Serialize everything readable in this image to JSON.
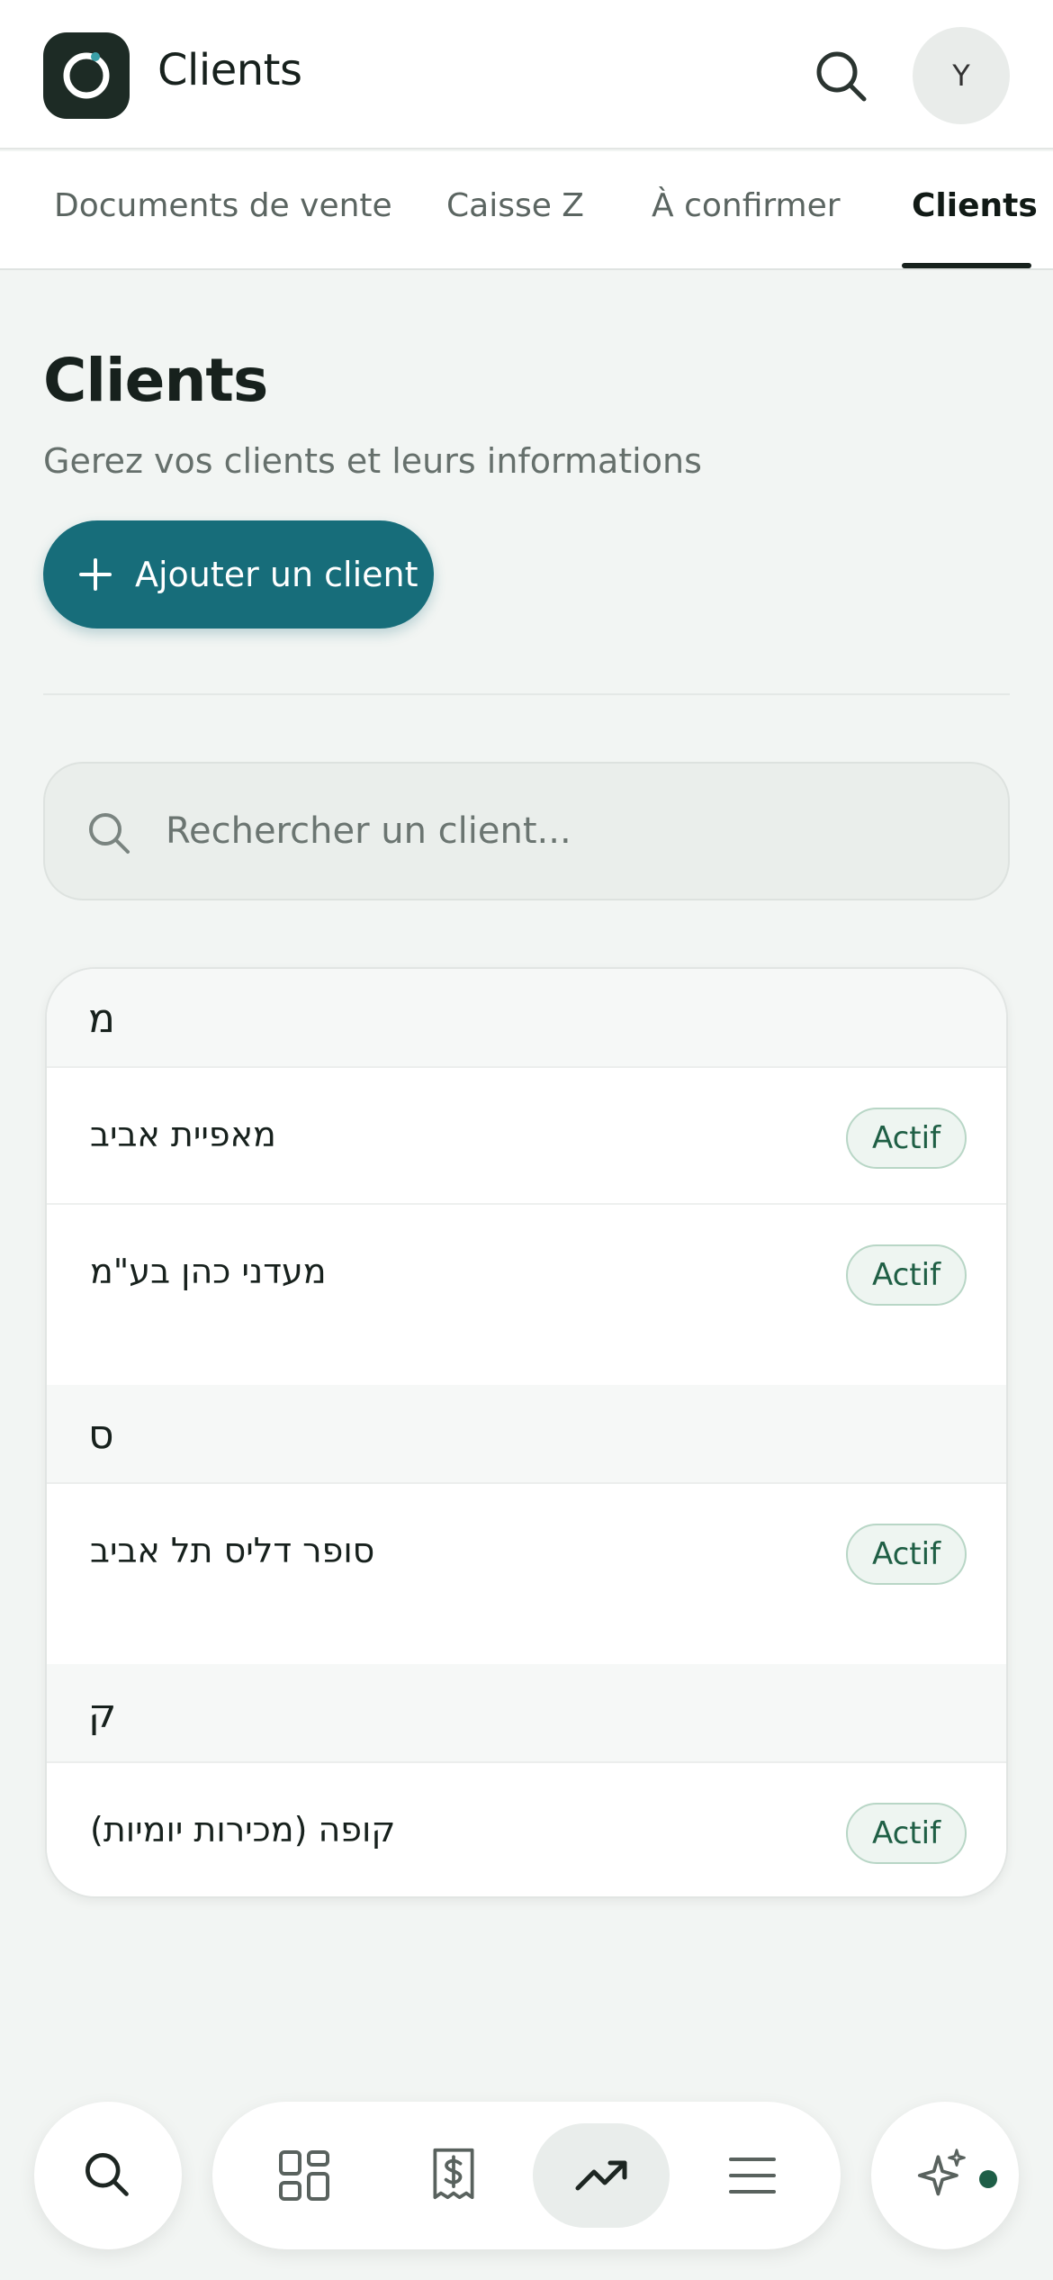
{
  "header": {
    "title": "Clients",
    "avatar_initial": "Y"
  },
  "tabs": [
    {
      "label": "Documents de vente",
      "active": false
    },
    {
      "label": "Caisse Z",
      "active": false
    },
    {
      "label": "À confirmer",
      "active": false
    },
    {
      "label": "Clients",
      "active": true
    }
  ],
  "page": {
    "title": "Clients",
    "subtitle": "Gerez vos clients et leurs informations",
    "add_button_label": "Ajouter un client"
  },
  "search": {
    "placeholder": "Rechercher un client...",
    "value": ""
  },
  "client_groups": [
    {
      "letter": "מ",
      "clients": [
        {
          "name": "מאפיית אביב",
          "status": "Actif"
        },
        {
          "name": "מעדני כהן בע\"מ",
          "status": "Actif"
        }
      ]
    },
    {
      "letter": "ס",
      "clients": [
        {
          "name": "סופר דליס תל אביב",
          "status": "Actif"
        }
      ]
    },
    {
      "letter": "ק",
      "clients": [
        {
          "name": "קופה (מכירות יומיות)",
          "status": "Actif"
        }
      ]
    }
  ],
  "bottom_nav": {
    "items": [
      {
        "icon": "search-icon"
      },
      {
        "icon": "dashboard-grid-icon"
      },
      {
        "icon": "receipt-dollar-icon"
      },
      {
        "icon": "trending-up-icon",
        "active": true
      },
      {
        "icon": "menu-icon"
      },
      {
        "icon": "sparkles-icon",
        "has_notification": true
      }
    ]
  },
  "colors": {
    "accent": "#176d7a",
    "badge_text": "#1f5f45",
    "badge_border": "#b8d6c6",
    "background": "#f2f5f3",
    "logo_bg": "#1d2b25"
  }
}
